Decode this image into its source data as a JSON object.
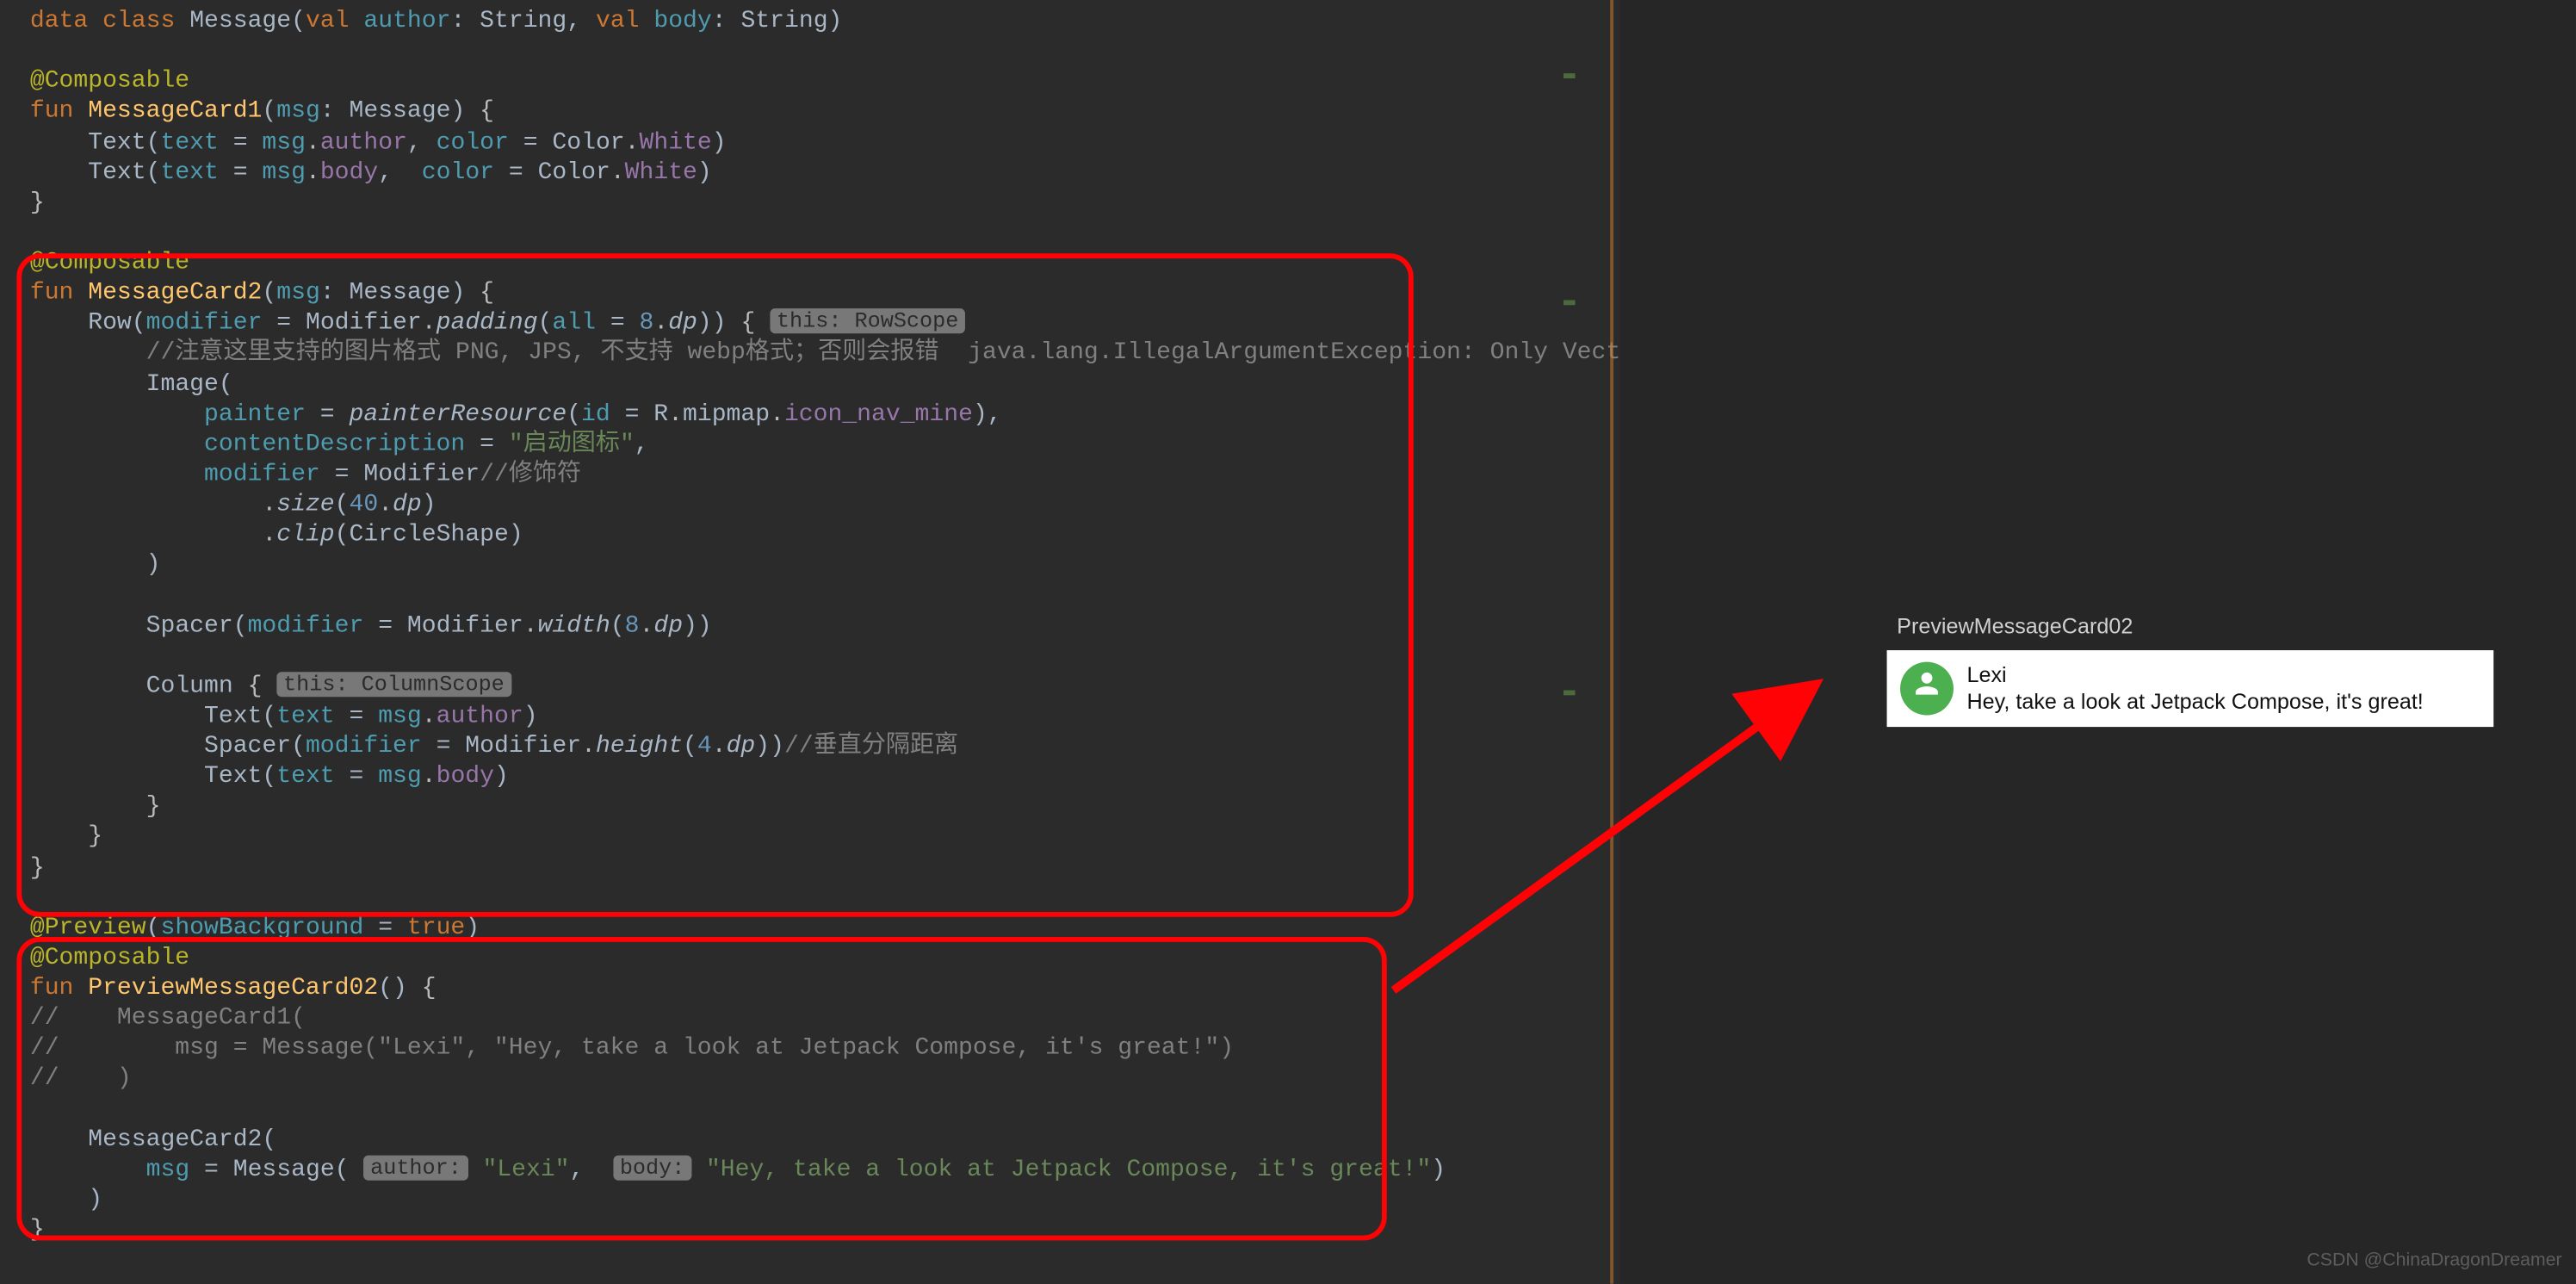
{
  "code": {
    "l1_data": "data",
    "l1_class": "class",
    "l1_msg": "Message",
    "l1_val": "val",
    "l1_author": "author",
    "l1_string": "String",
    "l1_body": "body",
    "composable": "@Composable",
    "fun": "fun",
    "mc1": "MessageCard1",
    "msg_param": "msg",
    "msg_type": "Message",
    "text_call": "Text",
    "text_kw": "text",
    "color_kw": "color",
    "Color": "Color",
    "White": "White",
    "author_prop": "author",
    "body_prop": "body",
    "mc2": "MessageCard2",
    "Row": "Row",
    "modifier": "modifier",
    "Modifier": "Modifier",
    "padding": "padding",
    "all": "all",
    "eight": "8",
    "dp": "dp",
    "this_row": "this: RowScope",
    "comm1": "//注意这里支持的图片格式 PNG, JPS, 不支持 webp格式；否则会报错  java.lang.IllegalArgumentException: Only Vector",
    "Image": "Image",
    "painter": "painter",
    "painterResource": "painterResource",
    "id": "id",
    "R": "R",
    "mipmap": "mipmap",
    "icon_nav": "icon_nav_mine",
    "contentDescription": "contentDescription",
    "desc_str": "\"启动图标\"",
    "mod_comm": "//修饰符",
    "size": "size",
    "forty": "40",
    "clip": "clip",
    "CircleShape": "CircleShape",
    "Spacer": "Spacer",
    "width": "width",
    "Column": "Column",
    "this_col": "this: ColumnScope",
    "height": "height",
    "four": "4",
    "vspace_comm": "//垂直分隔距离",
    "Preview": "@Preview",
    "showBg": "showBackground",
    "true": "true",
    "pmc02": "PreviewMessageCard02",
    "c_mc1": "//    MessageCard1(",
    "c_msg": "//        msg = Message(\"Lexi\", \"Hey, take a look at Jetpack Compose, it's great!\")",
    "c_close": "//    )",
    "msg_kw": "msg",
    "Message": "Message",
    "pill_author": "author:",
    "pill_body": "body:",
    "s_lexi": "\"Lexi\"",
    "s_body": "\"Hey, take a look at Jetpack Compose, it's great!\""
  },
  "preview": {
    "title": "PreviewMessageCard02",
    "card": {
      "author": "Lexi",
      "body": "Hey, take a look at Jetpack Compose, it's great!",
      "avatar_icon": "person-icon"
    }
  },
  "watermark": "CSDN @ChinaDragonDreamer"
}
